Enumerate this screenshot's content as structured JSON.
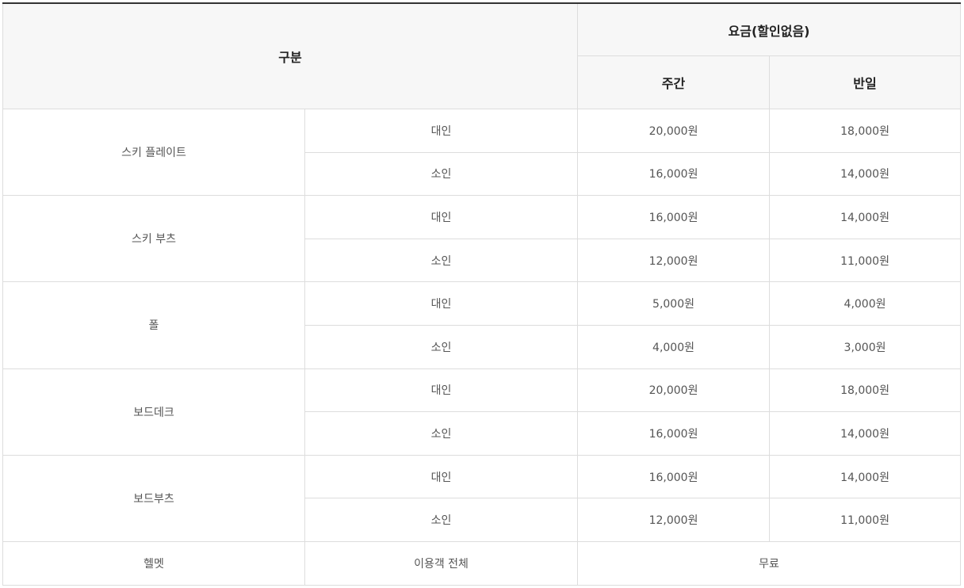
{
  "header": {
    "category": "구분",
    "price_group": "요금(할인없음)",
    "day": "주간",
    "half_day": "반일"
  },
  "items": [
    {
      "name": "스키 플레이트",
      "rows": [
        {
          "type": "대인",
          "day": "20,000원",
          "half_day": "18,000원"
        },
        {
          "type": "소인",
          "day": "16,000원",
          "half_day": "14,000원"
        }
      ]
    },
    {
      "name": "스키 부츠",
      "rows": [
        {
          "type": "대인",
          "day": "16,000원",
          "half_day": "14,000원"
        },
        {
          "type": "소인",
          "day": "12,000원",
          "half_day": "11,000원"
        }
      ]
    },
    {
      "name": "폴",
      "rows": [
        {
          "type": "대인",
          "day": "5,000원",
          "half_day": "4,000원"
        },
        {
          "type": "소인",
          "day": "4,000원",
          "half_day": "3,000원"
        }
      ]
    },
    {
      "name": "보드데크",
      "rows": [
        {
          "type": "대인",
          "day": "20,000원",
          "half_day": "18,000원"
        },
        {
          "type": "소인",
          "day": "16,000원",
          "half_day": "14,000원"
        }
      ]
    },
    {
      "name": "보드부츠",
      "rows": [
        {
          "type": "대인",
          "day": "16,000원",
          "half_day": "14,000원"
        },
        {
          "type": "소인",
          "day": "12,000원",
          "half_day": "11,000원"
        }
      ]
    }
  ],
  "helmet": {
    "name": "헬멧",
    "target": "이용객 전체",
    "price": "무료"
  },
  "colors": {
    "header_bg": "#f7f7f7",
    "border": "#dddddd",
    "top_border": "#333333"
  }
}
